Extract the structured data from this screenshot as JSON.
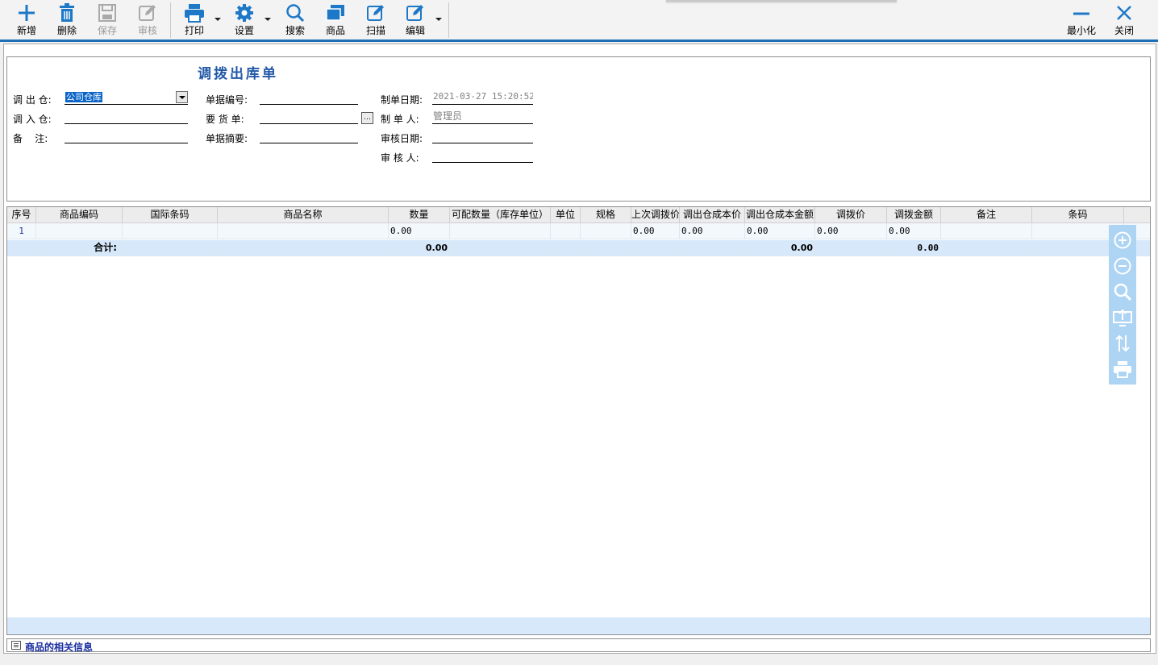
{
  "toolbar": {
    "buttons": [
      {
        "label": "新增",
        "icon": "plus-icon"
      },
      {
        "label": "删除",
        "icon": "trash-icon"
      },
      {
        "label": "保存",
        "icon": "save-icon"
      },
      {
        "label": "审核",
        "icon": "audit-icon"
      },
      {
        "label": "打印",
        "icon": "print-icon"
      },
      {
        "label": "设置",
        "icon": "gear-icon"
      },
      {
        "label": "搜索",
        "icon": "search-icon"
      },
      {
        "label": "商品",
        "icon": "goods-icon"
      },
      {
        "label": "扫描",
        "icon": "scan-icon"
      },
      {
        "label": "编辑",
        "icon": "edit-icon"
      }
    ],
    "minimize_label": "最小化",
    "close_label": "关闭"
  },
  "form": {
    "title": "调拨出库单",
    "out_warehouse_label": "调 出 仓:",
    "out_warehouse_value": "公司仓库",
    "in_warehouse_label": "调 入 仓:",
    "in_warehouse_value": "",
    "remark_label": "备    注:",
    "remark_value": "",
    "doc_no_label": "单据编号:",
    "doc_no_value": "",
    "request_label": "要 货 单:",
    "request_value": "",
    "summary_label": "单据摘要:",
    "summary_value": "",
    "create_date_label": "制单日期:",
    "create_date_value": "2021-03-27 15:20:52",
    "creator_label": "制 单 人:",
    "creator_value": "管理员",
    "audit_date_label": "审核日期:",
    "audit_date_value": "",
    "auditor_label": "审 核 人:",
    "auditor_value": ""
  },
  "grid": {
    "columns": [
      "序号",
      "商品编码",
      "国际条码",
      "商品名称",
      "数量",
      "可配数量（库存单位）",
      "单位",
      "规格",
      "上次调拨价",
      "调出仓成本价",
      "调出仓成本金额",
      "调拨价",
      "调拨金额",
      "备注",
      "条码"
    ],
    "row": {
      "seq": "1",
      "qty": "0.00",
      "last_price": "0.00",
      "cost_price": "0.00",
      "cost_amount": "0.00",
      "transfer_price": "0.00",
      "transfer_amount": "0.00"
    },
    "total": {
      "label": "合计:",
      "qty": "0.00",
      "cost_amount": "0.00",
      "transfer_amount": "0.00"
    }
  },
  "side_tools": [
    "add-row-icon",
    "remove-row-icon",
    "zoom-icon",
    "export-icon",
    "sort-icon",
    "print-icon"
  ],
  "info_bar": {
    "label": "商品的相关信息"
  }
}
